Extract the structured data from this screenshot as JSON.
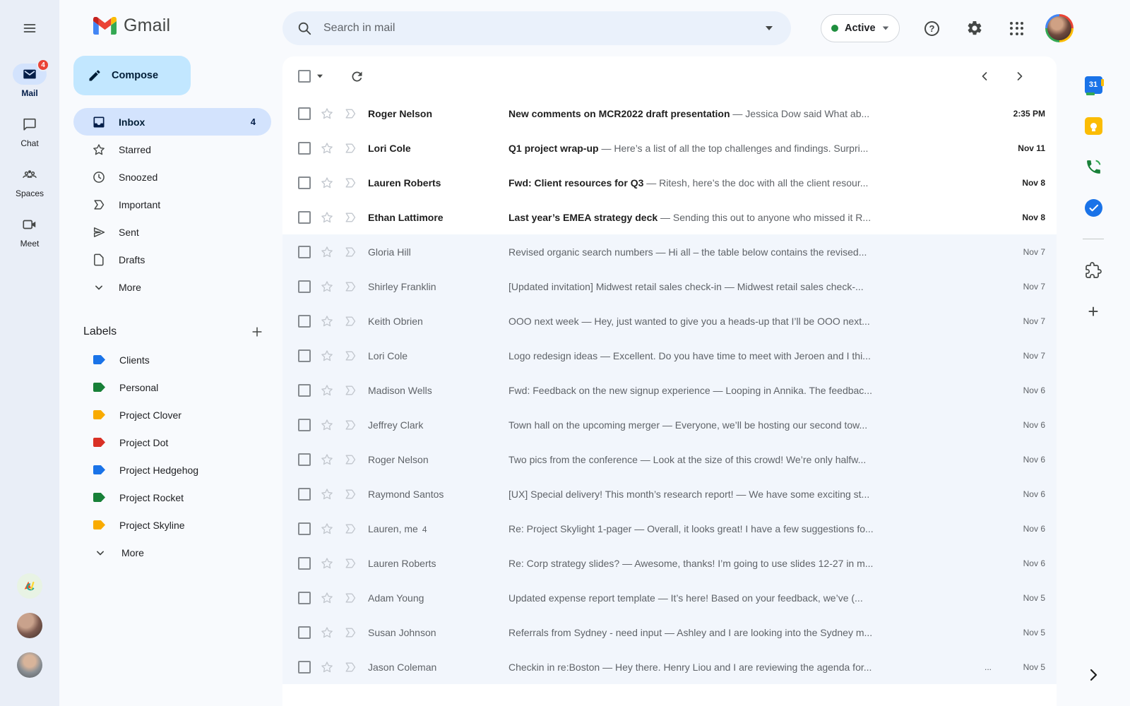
{
  "header": {
    "brand": "Gmail",
    "search_placeholder": "Search in mail",
    "status_label": "Active",
    "status_color": "#1e8e3e"
  },
  "rail": {
    "items": [
      {
        "label": "Mail",
        "icon": "mail",
        "active": true,
        "badge": "4"
      },
      {
        "label": "Chat",
        "icon": "chat",
        "active": false
      },
      {
        "label": "Spaces",
        "icon": "spaces",
        "active": false
      },
      {
        "label": "Meet",
        "icon": "meet",
        "active": false
      }
    ]
  },
  "sidebar": {
    "compose_label": "Compose",
    "nav": [
      {
        "label": "Inbox",
        "icon": "inbox",
        "count": "4",
        "active": true
      },
      {
        "label": "Starred",
        "icon": "star"
      },
      {
        "label": "Snoozed",
        "icon": "snooze"
      },
      {
        "label": "Important",
        "icon": "important"
      },
      {
        "label": "Sent",
        "icon": "sent"
      },
      {
        "label": "Drafts",
        "icon": "draft"
      },
      {
        "label": "More",
        "icon": "chevron-down"
      }
    ],
    "labels_title": "Labels",
    "labels": [
      {
        "name": "Clients",
        "color": "#1a73e8"
      },
      {
        "name": "Personal",
        "color": "#188038"
      },
      {
        "name": "Project Clover",
        "color": "#f9ab00"
      },
      {
        "name": "Project Dot",
        "color": "#d93025"
      },
      {
        "name": "Project Hedgehog",
        "color": "#1a73e8"
      },
      {
        "name": "Project Rocket",
        "color": "#188038"
      },
      {
        "name": "Project Skyline",
        "color": "#f9ab00"
      },
      {
        "name": "More",
        "color": "",
        "is_more": true
      }
    ]
  },
  "list": {
    "emails": [
      {
        "sender": "Roger Nelson",
        "subject": "New comments on MCR2022 draft presentation",
        "snippet": "— Jessica Dow said What ab...",
        "date": "2:35 PM",
        "unread": true
      },
      {
        "sender": "Lori Cole",
        "subject": "Q1 project wrap-up",
        "snippet": "— Here’s a list of all the top challenges and findings. Surpri...",
        "date": "Nov 11",
        "unread": true
      },
      {
        "sender": "Lauren Roberts",
        "subject": "Fwd: Client resources for Q3",
        "snippet": "— Ritesh, here’s the doc with all the client resour...",
        "date": "Nov 8",
        "unread": true
      },
      {
        "sender": "Ethan Lattimore",
        "subject": "Last year’s EMEA strategy deck",
        "snippet": "— Sending this out to anyone who missed it R...",
        "date": "Nov 8",
        "unread": true
      },
      {
        "sender": "Gloria Hill",
        "subject": "Revised organic search numbers",
        "snippet": "— Hi all – the table below contains the revised...",
        "date": "Nov 7",
        "unread": false
      },
      {
        "sender": "Shirley Franklin",
        "subject": "[Updated invitation] Midwest retail sales check-in",
        "snippet": "— Midwest retail sales check-...",
        "date": "Nov 7",
        "unread": false
      },
      {
        "sender": "Keith Obrien",
        "subject": "OOO next week",
        "snippet": "— Hey, just wanted to give you a heads-up that I’ll be OOO next...",
        "date": "Nov 7",
        "unread": false
      },
      {
        "sender": "Lori Cole",
        "subject": "Logo redesign ideas",
        "snippet": "— Excellent. Do you have time to meet with Jeroen and I thi...",
        "date": "Nov 7",
        "unread": false
      },
      {
        "sender": "Madison Wells",
        "subject": "Fwd: Feedback on the new signup experience",
        "snippet": "— Looping in Annika. The feedbac...",
        "date": "Nov 6",
        "unread": false
      },
      {
        "sender": "Jeffrey Clark",
        "subject": "Town hall on the upcoming merger",
        "snippet": "— Everyone, we’ll be hosting our second tow...",
        "date": "Nov 6",
        "unread": false
      },
      {
        "sender": "Roger Nelson",
        "subject": "Two pics from the conference",
        "snippet": "— Look at the size of this crowd! We’re only halfw...",
        "date": "Nov 6",
        "unread": false
      },
      {
        "sender": "Raymond Santos",
        "subject": "[UX] Special delivery! This month’s research report!",
        "snippet": "— We have some exciting st...",
        "date": "Nov 6",
        "unread": false
      },
      {
        "sender": "Lauren, me",
        "thread_count": "4",
        "subject": "Re: Project Skylight 1-pager",
        "snippet": "— Overall, it looks great! I have a few suggestions fo...",
        "date": "Nov 6",
        "unread": false
      },
      {
        "sender": "Lauren Roberts",
        "subject": "Re: Corp strategy slides?",
        "snippet": "— Awesome, thanks! I’m going to use slides 12-27 in m...",
        "date": "Nov 6",
        "unread": false
      },
      {
        "sender": "Adam Young",
        "subject": "Updated expense report template",
        "snippet": "— It’s here! Based on your feedback, we’ve (...",
        "date": "Nov 5",
        "unread": false
      },
      {
        "sender": "Susan Johnson",
        "subject": "Referrals from Sydney - need input",
        "snippet": "— Ashley and I are looking into the Sydney m...",
        "date": "Nov 5",
        "unread": false
      },
      {
        "sender": "Jason Coleman",
        "subject": "Checkin in re:Boston",
        "snippet": "— Hey there. Henry Liou and I are reviewing the agenda for...",
        "date": "Nov 5",
        "unread": false,
        "pre_date": "..."
      }
    ]
  },
  "right_rail": {
    "calendar_day": "31"
  }
}
